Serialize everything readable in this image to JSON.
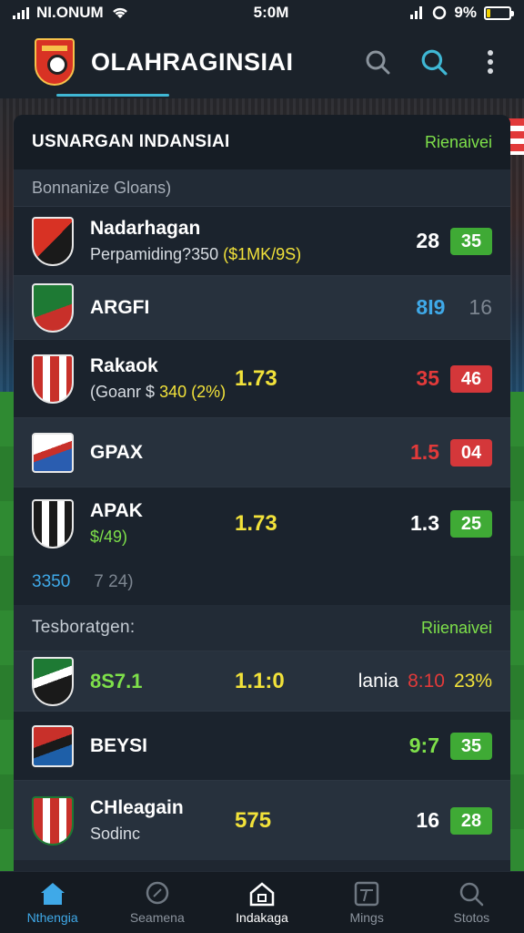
{
  "status_bar": {
    "carrier": "NI.ONUM",
    "time": "5:0M",
    "battery": "9%",
    "battery_level": 0.15
  },
  "app_bar": {
    "title": "OLAHRAGINSIAI"
  },
  "section1": {
    "title": "USNARGAN INDANSIAI",
    "link": "Rienaivei",
    "subheading": "Bonnanize Gloans)"
  },
  "rows": [
    {
      "name": "Nadarhagan",
      "sub_prefix": "Perpamiding?350",
      "sub_highlight": "($1MK/9S)",
      "mid": "",
      "right_value": "28",
      "pill": "35",
      "pill_color": "#3faa35"
    },
    {
      "name": "ARGFI",
      "sub_prefix": "",
      "sub_highlight": "",
      "mid": "",
      "right_value": "8I9",
      "secondary": "16",
      "pill": "",
      "pill_color": ""
    },
    {
      "name": "Rakaok",
      "sub_prefix": "(Goanr $",
      "sub_highlight": "340 (2%)",
      "mid": "1.73",
      "right_value": "35",
      "pill": "46",
      "pill_color": "#d4373a"
    },
    {
      "name": "GPAX",
      "sub_prefix": "",
      "sub_highlight": "",
      "mid": "",
      "right_value": "1.5",
      "pill": "04",
      "pill_color": "#d4373a"
    },
    {
      "name": "APAK",
      "sub_prefix": "",
      "sub_highlight": "$/49)",
      "mid": "1.73",
      "right_value": "1.3",
      "pill": "25",
      "pill_color": "#3faa35"
    }
  ],
  "extra_line": {
    "left": "3350",
    "right": "7 24)"
  },
  "section2": {
    "title": "Tesboratgen:",
    "link": "Riienaivei"
  },
  "rows2": [
    {
      "name": "8S7.1",
      "mid": "1.1:0",
      "label": "lania",
      "score": "8:10",
      "pct": "23%"
    },
    {
      "name": "BEYSI",
      "right_value": "9:7",
      "pill": "35"
    },
    {
      "name": "CHleagain",
      "sub": "Sodinc",
      "mid": "575",
      "right_value": "16",
      "pill": "28"
    }
  ],
  "bottom_nav": [
    {
      "label": "Nthengia",
      "icon": "home-icon"
    },
    {
      "label": "Seamena",
      "icon": "search-icon"
    },
    {
      "label": "Indakaga",
      "icon": "house-icon"
    },
    {
      "label": "Mings",
      "icon": "grid-icon"
    },
    {
      "label": "Stotos",
      "icon": "magnifier-icon"
    }
  ],
  "colors": {
    "accent_green": "#3faa35",
    "accent_red": "#d4373a",
    "accent_yellow": "#f2e23a",
    "accent_blue": "#3fa9e8"
  }
}
